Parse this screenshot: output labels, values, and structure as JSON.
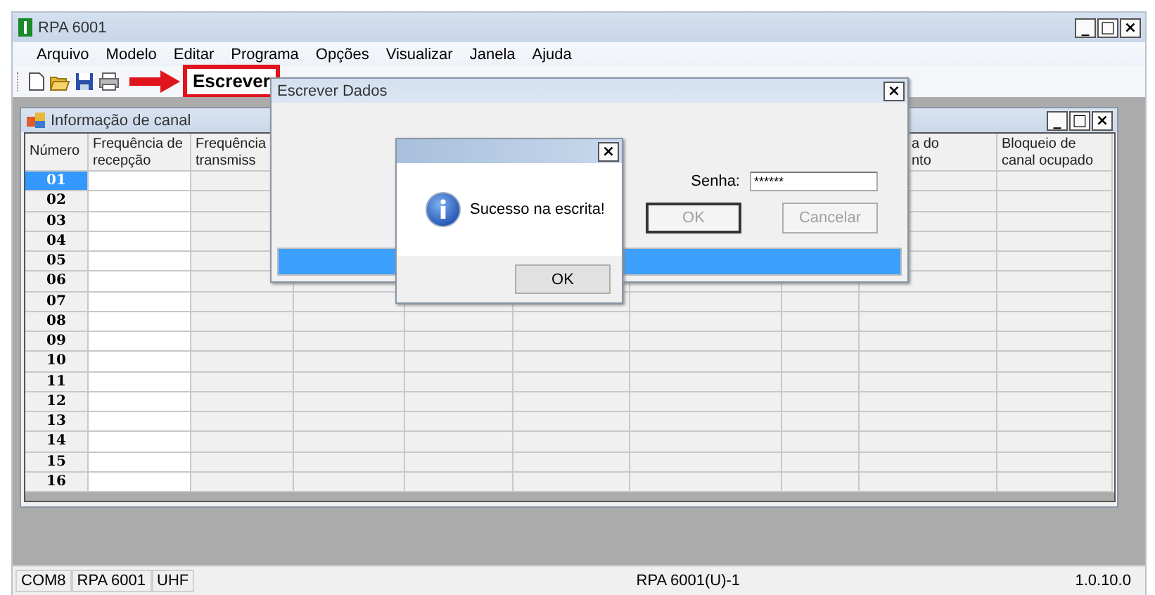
{
  "window": {
    "title": "RPA 6001",
    "controls": [
      "_",
      "□",
      "×"
    ]
  },
  "menu": [
    "Arquivo",
    "Modelo",
    "Editar",
    "Programa",
    "Opções",
    "Visualizar",
    "Janela",
    "Ajuda"
  ],
  "callout": {
    "label": "Escrever"
  },
  "channel_window": {
    "title": "Informação de canal",
    "controls": [
      "_",
      "□",
      "×"
    ],
    "columns": [
      {
        "header": "Número"
      },
      {
        "header": "Frequência de\nrecepção"
      },
      {
        "header": "Frequência\ntransmiss"
      },
      {},
      {},
      {},
      {},
      {},
      {
        "header": "a do\nnto"
      },
      {
        "header": "Bloqueio de\ncanal ocupado"
      }
    ],
    "rows": [
      {
        "number": "01",
        "selected": true
      },
      {
        "number": "02",
        "selected": false
      },
      {
        "number": "03",
        "selected": false
      },
      {
        "number": "04",
        "selected": false
      },
      {
        "number": "05",
        "selected": false
      },
      {
        "number": "06",
        "selected": false
      },
      {
        "number": "07",
        "selected": false
      },
      {
        "number": "08",
        "selected": false
      },
      {
        "number": "09",
        "selected": false
      },
      {
        "number": "10",
        "selected": false
      },
      {
        "number": "11",
        "selected": false
      },
      {
        "number": "12",
        "selected": false
      },
      {
        "number": "13",
        "selected": false
      },
      {
        "number": "14",
        "selected": false
      },
      {
        "number": "15",
        "selected": false
      },
      {
        "number": "16",
        "selected": false
      }
    ]
  },
  "write_dialog": {
    "title": "Escrever Dados",
    "close": "×",
    "password_label": "Senha:",
    "password": "******",
    "buttons": [
      {
        "label": "OK",
        "disabled": true,
        "default": true
      },
      {
        "label": "Cancelar",
        "disabled": true,
        "default": false
      }
    ],
    "progress": {
      "level": 1
    }
  },
  "message_box": {
    "close": "×",
    "message": "Sucesso na escrita!",
    "button": "OK"
  },
  "status_bar": {
    "panels": [
      "COM8",
      "RPA 6001",
      "UHF"
    ],
    "center": "RPA 6001(U)-1",
    "version": "1.0.10.0"
  }
}
